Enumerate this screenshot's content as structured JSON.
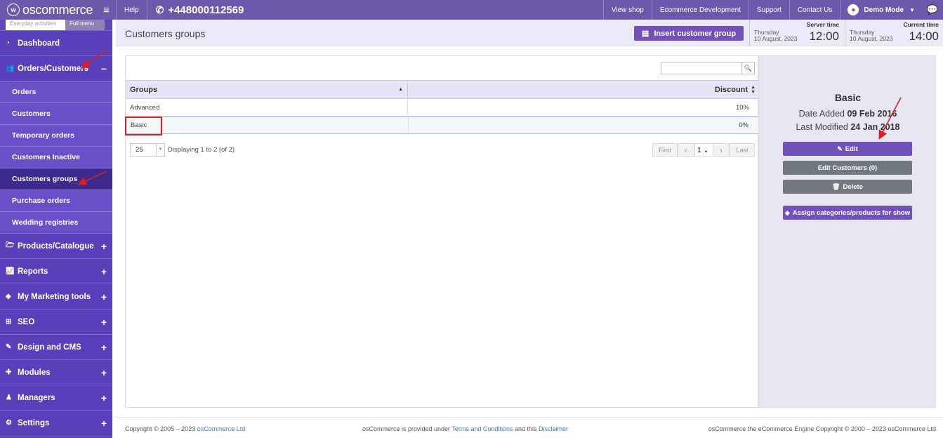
{
  "topbar": {
    "logo": "oscommerce",
    "help": "Help",
    "phone": "+448000112569",
    "links": [
      "View shop",
      "Ecommerce Development",
      "Support",
      "Contact Us"
    ],
    "user": "Demo Mode"
  },
  "sidebar": {
    "tab_everyday": "Everyday activities",
    "tab_full": "Full menu",
    "items": [
      {
        "label": "Dashboard",
        "icon": "dashboard-icon"
      },
      {
        "label": "Orders/Customers",
        "icon": "users-icon",
        "toggle": "−"
      },
      {
        "label": "Products/Catalogue",
        "icon": "folder-icon",
        "toggle": "+"
      },
      {
        "label": "Reports",
        "icon": "chart-icon",
        "toggle": "+"
      },
      {
        "label": "My Marketing tools",
        "icon": "tag-icon",
        "toggle": "+"
      },
      {
        "label": "SEO",
        "icon": "sitemap-icon",
        "toggle": "+"
      },
      {
        "label": "Design and CMS",
        "icon": "brush-icon",
        "toggle": "+"
      },
      {
        "label": "Modules",
        "icon": "puzzle-icon",
        "toggle": "+"
      },
      {
        "label": "Managers",
        "icon": "user-icon",
        "toggle": "+"
      },
      {
        "label": "Settings",
        "icon": "cogs-icon",
        "toggle": "+"
      }
    ],
    "subitems": [
      "Orders",
      "Customers",
      "Temporary orders",
      "Customers Inactive",
      "Customers groups",
      "Purchase orders",
      "Wedding registries"
    ]
  },
  "header": {
    "title": "Customers groups",
    "insert_button": "Insert customer group",
    "server_time": {
      "label": "Server time",
      "day": "Thursday",
      "date": "10 August, 2023",
      "time": "12:00"
    },
    "current_time": {
      "label": "Current time",
      "day": "Thursday",
      "date": "10 August, 2023",
      "time": "14:00"
    }
  },
  "table": {
    "columns": [
      "Groups",
      "Discount"
    ],
    "rows": [
      {
        "group": "Advanced",
        "discount": "10%"
      },
      {
        "group": "Basic",
        "discount": "0%"
      }
    ],
    "per_page": "25",
    "displaying": "Displaying 1 to 2 (of 2)",
    "pager": {
      "first": "First",
      "page": "1",
      "last": "Last"
    }
  },
  "details": {
    "title": "Basic",
    "date_added_label": "Date Added",
    "date_added": "09 Feb 2016",
    "last_modified_label": "Last Modified",
    "last_modified": "24 Jan 2018",
    "buttons": {
      "edit": "Edit",
      "edit_customers": "Edit Customers (0)",
      "delete": "Delete",
      "assign": "Assign categories/products for show"
    }
  },
  "footer": {
    "copyright": "Copyright © 2005 – 2023",
    "company_link": "osCommerce Ltd",
    "provided": "osCommerce is provided under",
    "terms_link": "Terms and Conditions",
    "and_this": "and this",
    "disclaimer_link": "Disclaimer",
    "engine": "osCommerce the eCommerce Engine Copyright © 2000 – 2023 osCommerce Ltd"
  },
  "colors": {
    "brand": "#6b5aac",
    "sidebar": "#5f48b8",
    "accent_button": "#7152b8",
    "annotation": "#d92020"
  }
}
